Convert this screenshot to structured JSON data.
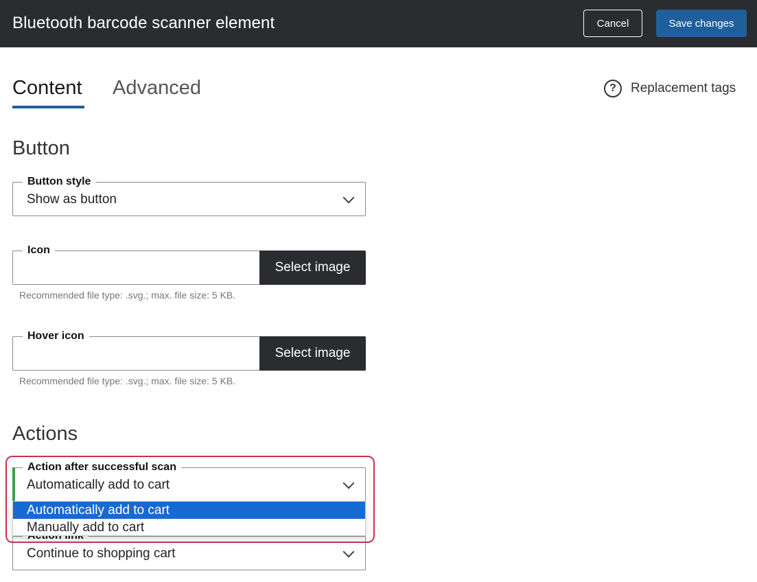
{
  "header": {
    "title": "Bluetooth barcode scanner element",
    "cancel_label": "Cancel",
    "save_label": "Save changes"
  },
  "tabs": [
    {
      "label": "Content",
      "active": true
    },
    {
      "label": "Advanced",
      "active": false
    }
  ],
  "replacement_tags": {
    "label": "Replacement tags",
    "icon": "question-circle-icon"
  },
  "button_section": {
    "heading": "Button",
    "button_style": {
      "label": "Button style",
      "value": "Show as button"
    },
    "icon": {
      "label": "Icon",
      "button_label": "Select image",
      "hint": "Recommended file type: .svg.; max. file size: 5 KB."
    },
    "hover_icon": {
      "label": "Hover icon",
      "button_label": "Select image",
      "hint": "Recommended file type: .svg.; max. file size: 5 KB."
    }
  },
  "actions_section": {
    "heading": "Actions",
    "action_after_scan": {
      "label": "Action after successful scan",
      "value": "Automatically add to cart",
      "options": [
        "Automatically add to cart",
        "Manually add to cart"
      ]
    },
    "action_link": {
      "label": "Action link",
      "value": "Continue to shopping cart"
    }
  },
  "colors": {
    "topbar": "#2b2c30",
    "accent": "#1f5f9c",
    "dropdown_selected": "#1769d3",
    "highlight_border": "#c8304a",
    "focus_bar": "#3aa14a"
  }
}
